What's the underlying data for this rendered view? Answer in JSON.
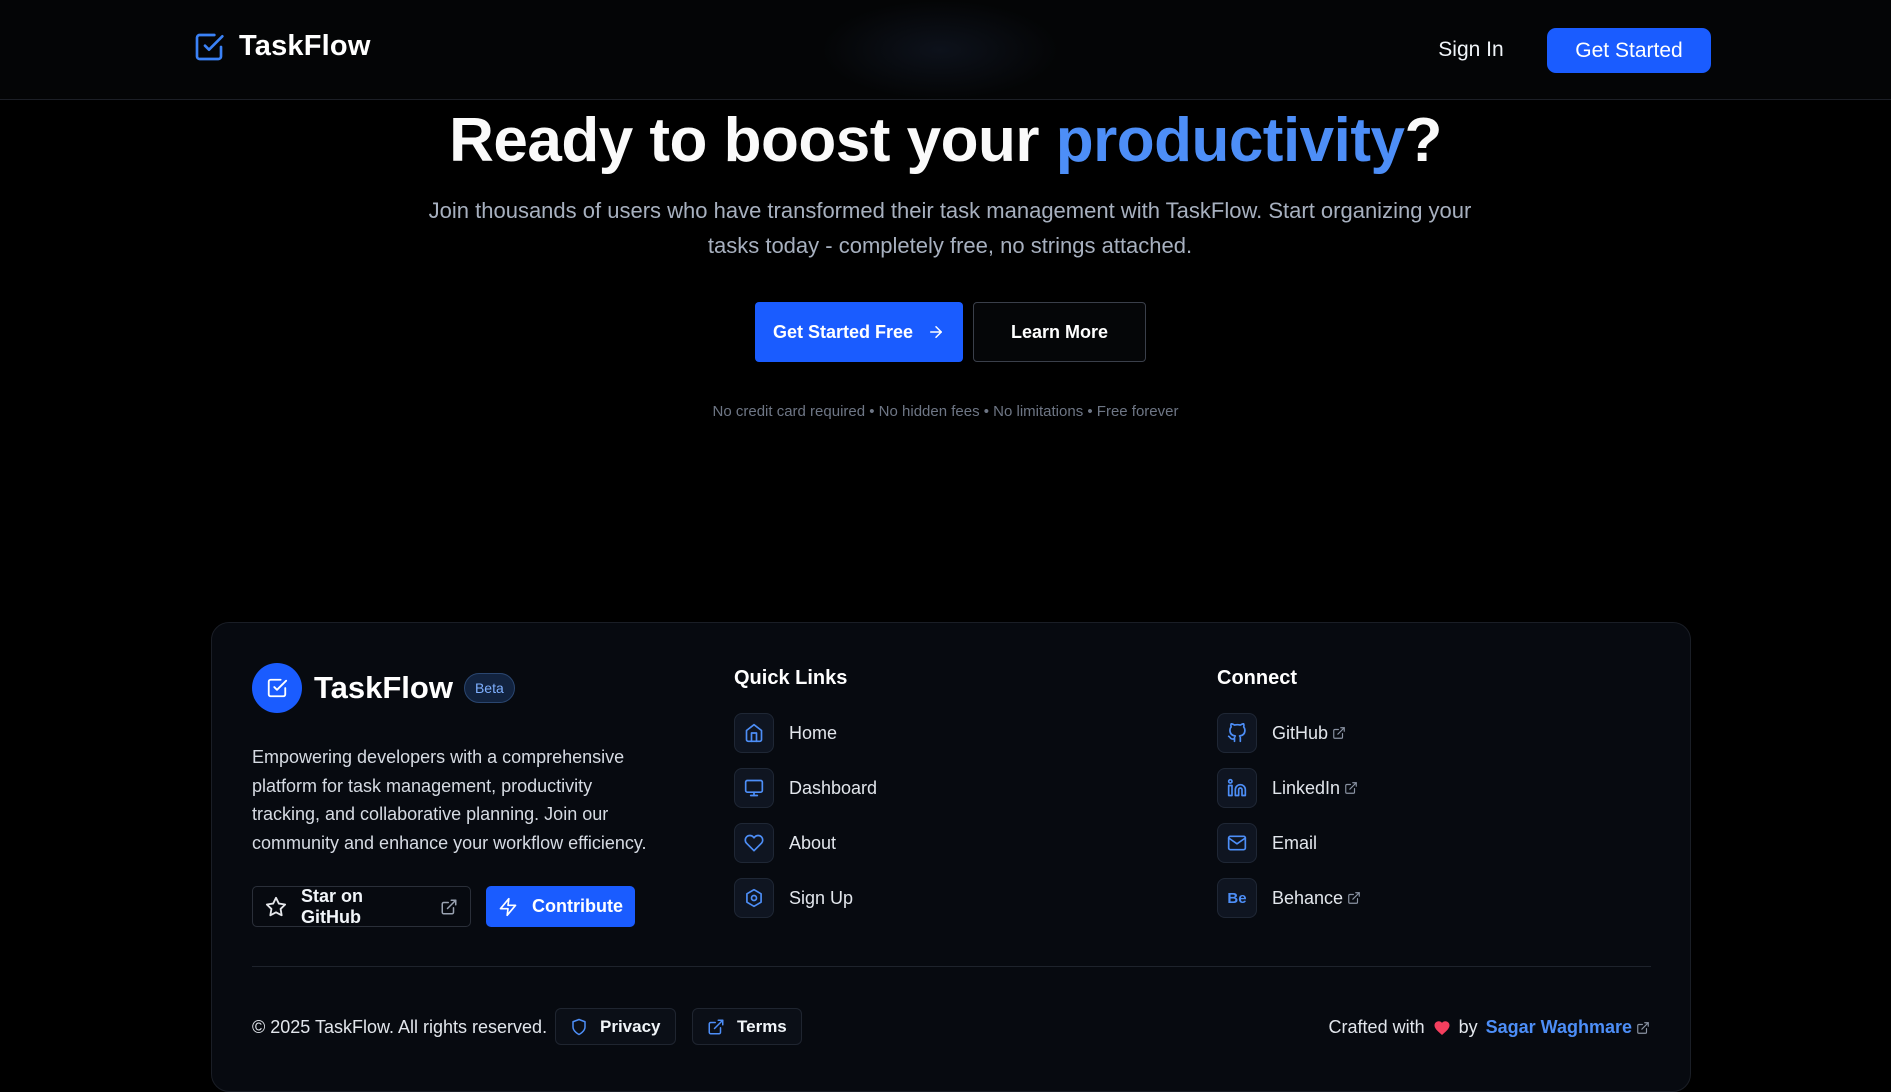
{
  "header": {
    "brand": "TaskFlow",
    "sign_in": "Sign In",
    "get_started": "Get Started"
  },
  "hero": {
    "title_part1": "Ready to boost your ",
    "title_accent": "productivity",
    "title_part2": "?",
    "subtitle": "Join thousands of users who have transformed their task management with TaskFlow. Start organizing your tasks today - completely free, no strings attached.",
    "cta_primary": "Get Started Free",
    "cta_secondary": "Learn More",
    "note": "No credit card required • No hidden fees • No limitations • Free forever"
  },
  "footer": {
    "brand": "TaskFlow",
    "badge": "Beta",
    "description": "Empowering developers with a comprehensive platform for task management, productivity tracking, and collaborative planning. Join our community and enhance your workflow efficiency.",
    "star_button": "Star on GitHub",
    "contribute_button": "Contribute",
    "quick_links": {
      "title": "Quick Links",
      "items": [
        {
          "label": "Home",
          "icon": "home-icon"
        },
        {
          "label": "Dashboard",
          "icon": "monitor-icon"
        },
        {
          "label": "About",
          "icon": "heart-icon"
        },
        {
          "label": "Sign Up",
          "icon": "settings-icon"
        }
      ]
    },
    "connect": {
      "title": "Connect",
      "items": [
        {
          "label": "GitHub",
          "icon": "github-icon",
          "external": true
        },
        {
          "label": "LinkedIn",
          "icon": "linkedin-icon",
          "external": true
        },
        {
          "label": "Email",
          "icon": "mail-icon",
          "external": false
        },
        {
          "label": "Behance",
          "icon": "behance-icon",
          "external": true,
          "glyph": "Be"
        }
      ]
    },
    "copyright": "© 2025 TaskFlow. All rights reserved.",
    "privacy": "Privacy",
    "terms": "Terms",
    "crafted_with": "Crafted with",
    "by": "by",
    "author": "Sagar Waghmare"
  },
  "colors": {
    "accent": "#1a5cff",
    "accent_text": "#4d8ef7",
    "heart": "#f43f5e"
  }
}
